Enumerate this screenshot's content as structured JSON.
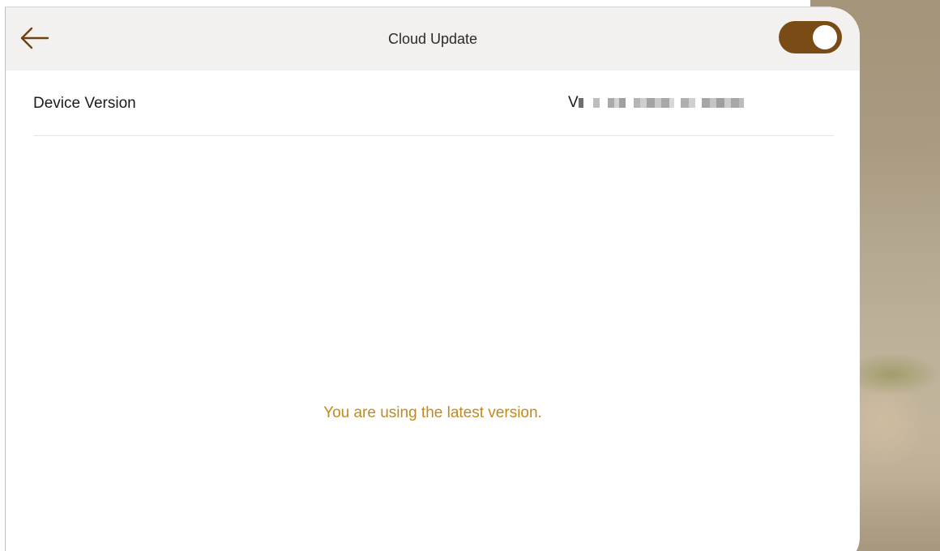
{
  "header": {
    "title": "Cloud Update",
    "back_icon": "back-arrow-icon",
    "toggle": {
      "state": "on",
      "color": "#7a4c15"
    }
  },
  "device_version": {
    "label": "Device Version",
    "value_prefix": "V"
  },
  "status_message": "You are using the latest version.",
  "colors": {
    "accent": "#7a4c15",
    "status_text": "#c08a1e",
    "header_bg": "#f2f1ef"
  }
}
